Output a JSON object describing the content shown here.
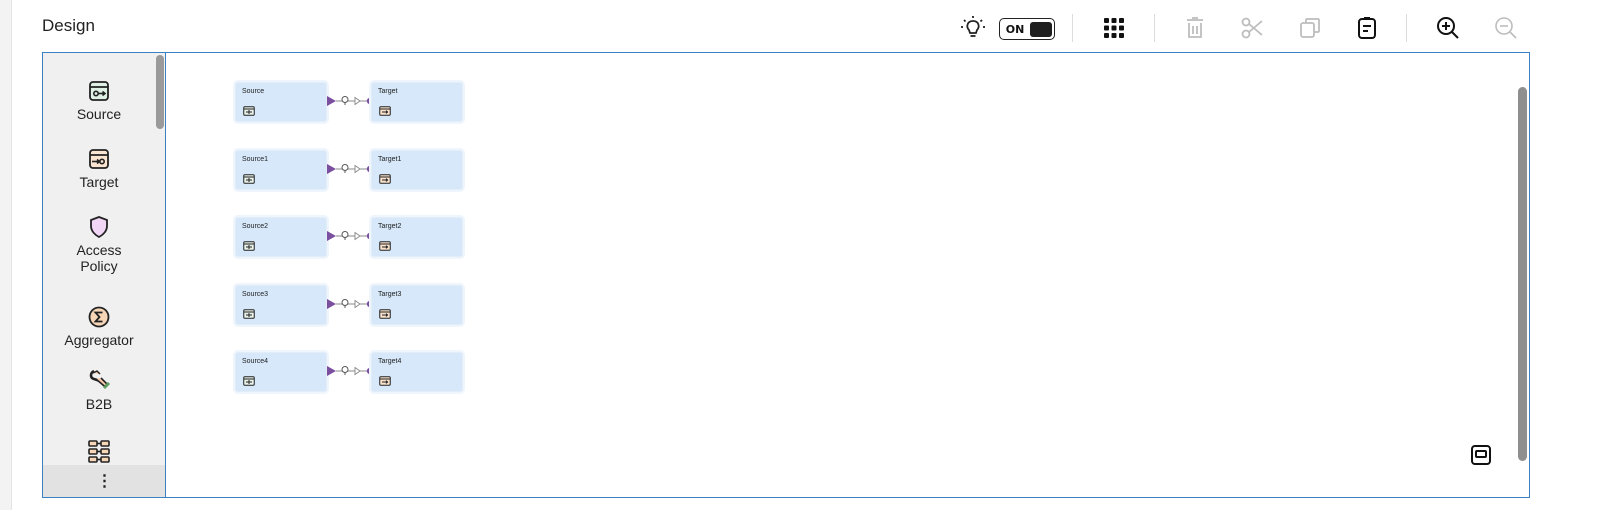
{
  "header": {
    "title": "Design"
  },
  "toolbar": {
    "bulb_icon": "lightbulb-icon",
    "toggle_label": "ON",
    "grid_icon": "grid-apps-icon",
    "delete_icon": "trash-icon",
    "cut_icon": "scissors-icon",
    "copy_icon": "copy-icon",
    "paste_icon": "clipboard-icon",
    "zoom_in_icon": "zoom-in-icon",
    "zoom_out_icon": "zoom-out-icon"
  },
  "palette": {
    "items": [
      {
        "label": "Source",
        "icon": "source-icon"
      },
      {
        "label": "Target",
        "icon": "target-icon"
      },
      {
        "label": "Access\nPolicy",
        "icon": "shield-icon"
      },
      {
        "label": "Aggregator",
        "icon": "sigma-icon"
      },
      {
        "label": "B2B",
        "icon": "b2b-icon"
      },
      {
        "label": "",
        "icon": "flow-icon"
      }
    ],
    "more_label": "⋮"
  },
  "canvas": {
    "flows": [
      {
        "source": "Source",
        "target": "Target"
      },
      {
        "source": "Source1",
        "target": "Target1"
      },
      {
        "source": "Source2",
        "target": "Target2"
      },
      {
        "source": "Source3",
        "target": "Target3"
      },
      {
        "source": "Source4",
        "target": "Target4"
      }
    ],
    "fit_icon": "fit-to-screen-icon"
  },
  "colors": {
    "accent": "#3b82c4",
    "node_fill": "#d6e8fa",
    "connector": "#7b4fa0",
    "palette_bg": "#f0f0f0"
  }
}
